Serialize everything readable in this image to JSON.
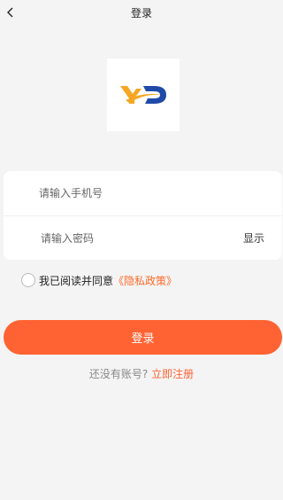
{
  "nav": {
    "title": "登录",
    "back_icon": "chevron-left-icon"
  },
  "logo": {
    "brand_colors": [
      "#f5a623",
      "#1f4aa8"
    ]
  },
  "form": {
    "phone_placeholder": "请输入手机号",
    "phone_value": "",
    "password_placeholder": "请输入密码",
    "password_value": "",
    "show_label": "显示"
  },
  "agreement": {
    "text": "我已阅读并同意",
    "policy_link": "《隐私政策》",
    "checked": false
  },
  "login_button": "登录",
  "register": {
    "prompt": "还没有账号?",
    "link": "立即注册"
  },
  "colors": {
    "accent": "#ff6333",
    "background": "#f4f4f4"
  }
}
